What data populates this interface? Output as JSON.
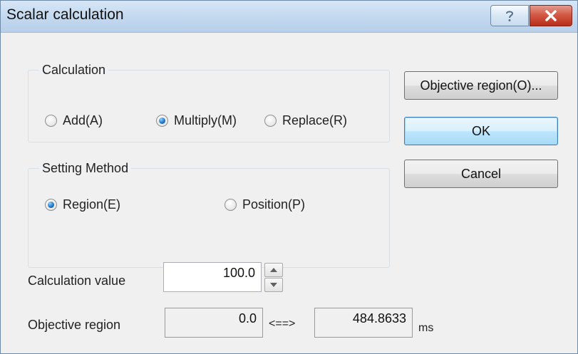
{
  "window": {
    "title": "Scalar calculation",
    "help_glyph": "?",
    "close_glyph": "✖"
  },
  "calculation_group": {
    "label": "Calculation",
    "options": [
      {
        "label": "Add(A)",
        "checked": false
      },
      {
        "label": "Multiply(M)",
        "checked": true
      },
      {
        "label": "Replace(R)",
        "checked": false
      }
    ]
  },
  "setting_method_group": {
    "label": "Setting Method",
    "options": [
      {
        "label": "Region(E)",
        "checked": true
      },
      {
        "label": "Position(P)",
        "checked": false
      }
    ]
  },
  "buttons": {
    "objective_region": "Objective region(O)...",
    "ok": "OK",
    "cancel": "Cancel"
  },
  "calculation_value": {
    "label": "Calculation value",
    "value": "100.0"
  },
  "objective_region": {
    "label": "Objective region",
    "start": "0.0",
    "separator": "<==>",
    "end": "484.8633",
    "unit": "ms"
  },
  "colors": {
    "titlebar": "#c2d8ef",
    "close_button": "#c84630",
    "default_button": "#bee6fd",
    "radio_checked": "#1a6fc0"
  },
  "icons": [
    "help-icon",
    "close-icon",
    "spin-up-icon",
    "spin-down-icon"
  ]
}
